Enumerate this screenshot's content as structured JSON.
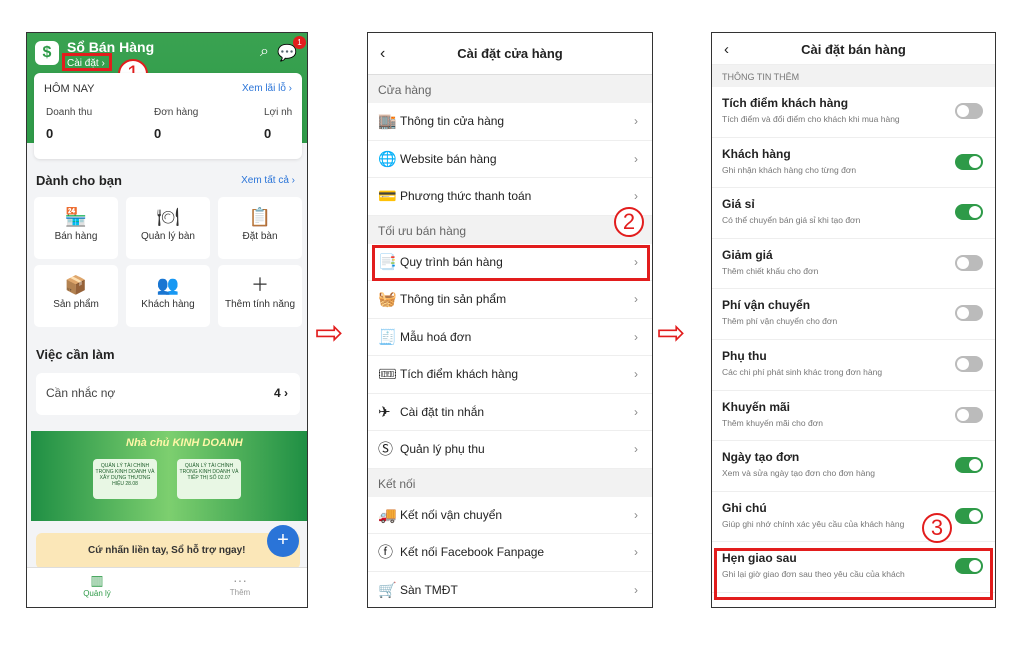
{
  "screen1": {
    "app_title": "Sổ Bán Hàng",
    "settings_link": "Cài đặt ›",
    "notif_count": "1",
    "today_label": "HÔM NAY",
    "profit_link": "Xem lãi lỗ ›",
    "stats": [
      {
        "label": "Doanh thu",
        "value": "0"
      },
      {
        "label": "Đơn hàng",
        "value": "0"
      },
      {
        "label": "Lợi nh",
        "value": "0"
      }
    ],
    "for_you_title": "Dành cho bạn",
    "see_all": "Xem tất cả ›",
    "tiles": [
      "Bán hàng",
      "Quản lý bàn",
      "Đặt bàn",
      "Sản phẩm",
      "Khách hàng",
      "Thêm tính năng"
    ],
    "todo_title": "Việc cần làm",
    "task_label": "Cần nhắc nợ",
    "task_count": "4 ›",
    "banner_title": "Nhà chủ KINH DOANH",
    "banner_card1": "QUẢN LÝ TÀI CHÍNH TRONG KINH DOANH VÀ XÂY DỰNG THƯƠNG HIỆU 28.08",
    "banner_card2": "QUẢN LÝ TÀI CHÍNH TRONG KINH DOANH VÀ TIẾP THỊ SỐ 02.07",
    "promo": "Cứ nhấn liền tay, Sổ hỗ trợ ngay!",
    "tabs": [
      "Quản lý",
      "Thêm"
    ],
    "step": "1"
  },
  "screen2": {
    "title": "Cài đặt cửa hàng",
    "groups": [
      {
        "name": "Cửa hàng",
        "items": [
          "Thông tin cửa hàng",
          "Website bán hàng",
          "Phương thức thanh toán"
        ]
      },
      {
        "name": "Tối ưu bán hàng",
        "items": [
          "Quy trình bán hàng",
          "Thông tin sản phẩm",
          "Mẫu hoá đơn",
          "Tích điểm khách hàng",
          "Cài đặt tin nhắn",
          "Quản lý phụ thu"
        ]
      },
      {
        "name": "Kết nối",
        "items": [
          "Kết nối vận chuyển",
          "Kết nối Facebook Fanpage",
          "Sàn TMĐT"
        ]
      }
    ],
    "step": "2"
  },
  "screen3": {
    "title": "Cài đặt bán hàng",
    "group": "THÔNG TIN THÊM",
    "rows": [
      {
        "title": "Tích điểm khách hàng",
        "desc": "Tích điểm và đổi điểm cho khách khi mua hàng",
        "on": false
      },
      {
        "title": "Khách hàng",
        "desc": "Ghi nhận khách hàng cho từng đơn",
        "on": true
      },
      {
        "title": "Giá sỉ",
        "desc": "Có thể chuyển bán giá sỉ khi tạo đơn",
        "on": true
      },
      {
        "title": "Giảm giá",
        "desc": "Thêm chiết khấu cho đơn",
        "on": false
      },
      {
        "title": "Phí vận chuyển",
        "desc": "Thêm phí vận chuyển cho đơn",
        "on": false
      },
      {
        "title": "Phụ thu",
        "desc": "Các chi phí phát sinh khác trong đơn hàng",
        "on": false
      },
      {
        "title": "Khuyến mãi",
        "desc": "Thêm khuyến mãi cho đơn",
        "on": false
      },
      {
        "title": "Ngày tạo đơn",
        "desc": "Xem và sửa ngày tạo đơn cho đơn hàng",
        "on": true
      },
      {
        "title": "Ghi chú",
        "desc": "Giúp ghi nhớ chính xác yêu cầu của khách hàng",
        "on": true
      },
      {
        "title": "Hẹn giao sau",
        "desc": "Ghi lại giờ giao đơn sau theo yêu cầu của khách",
        "on": true
      }
    ],
    "step": "3"
  },
  "colors": {
    "brand_green": "#2e9a48",
    "highlight_red": "#e21d1d",
    "link_blue": "#2a74d8"
  }
}
